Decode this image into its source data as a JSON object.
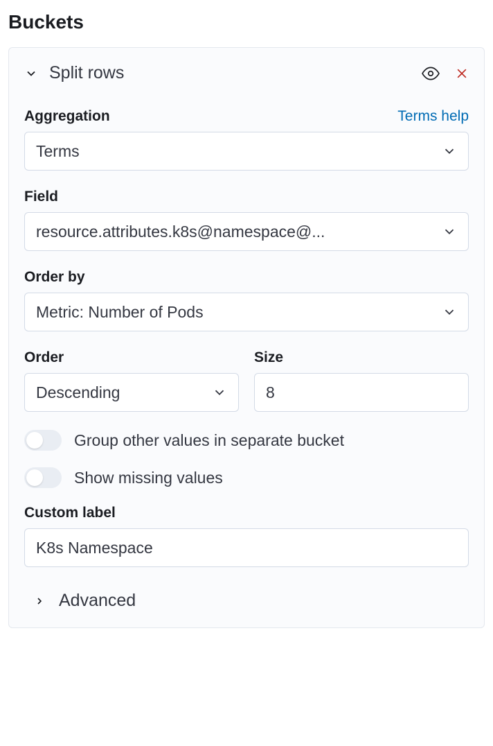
{
  "section_title": "Buckets",
  "panel": {
    "title": "Split rows",
    "help_link": "Terms help",
    "aggregation": {
      "label": "Aggregation",
      "value": "Terms"
    },
    "field": {
      "label": "Field",
      "value": "resource.attributes.k8s@namespace@..."
    },
    "order_by": {
      "label": "Order by",
      "value": "Metric: Number of Pods"
    },
    "order": {
      "label": "Order",
      "value": "Descending"
    },
    "size": {
      "label": "Size",
      "value": "8"
    },
    "switches": {
      "group_other": "Group other values in separate bucket",
      "show_missing": "Show missing values"
    },
    "custom_label": {
      "label": "Custom label",
      "value": "K8s Namespace"
    },
    "advanced_label": "Advanced"
  }
}
